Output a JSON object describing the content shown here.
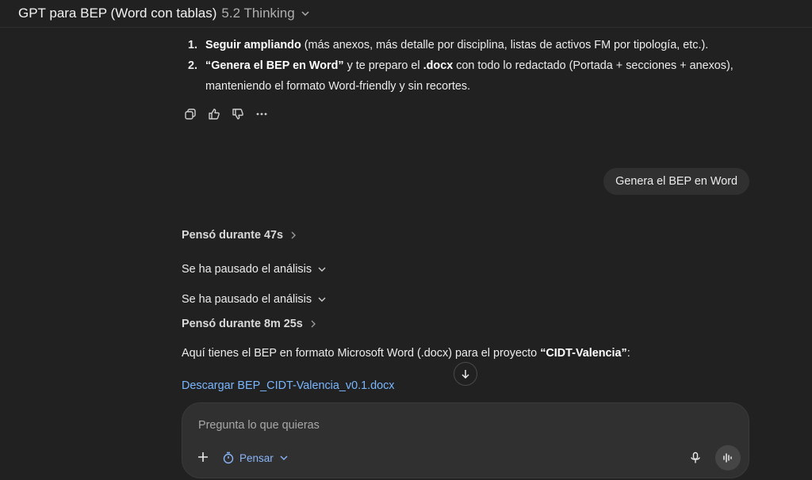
{
  "header": {
    "model_name": "GPT para BEP (Word con tablas)",
    "model_version": "5.2 Thinking"
  },
  "steps": [
    {
      "num": "1.",
      "bold": "Seguir ampliando",
      "text": " (más anexos, más detalle por disciplina, listas de activos FM por tipología, etc.)."
    },
    {
      "num": "2.",
      "bold_quote": "“Genera el BEP en Word”",
      "text_a": " y te preparo el ",
      "bold_docx": ".docx",
      "text_b": " con todo lo redactado (Portada + secciones + anexos),",
      "text_c": "manteniendo el formato Word-friendly y sin recortes."
    }
  ],
  "user_message": "Genera el BEP en Word",
  "thoughts": [
    {
      "label": "Pensó durante 47s"
    },
    {
      "label": "Se ha pausado el análisis"
    },
    {
      "label": "Se ha pausado el análisis"
    },
    {
      "label": "Pensó durante 8m 25s"
    }
  ],
  "reply": {
    "text": "Aquí tienes el BEP en formato Microsoft Word (.docx) para el proyecto ",
    "project": "“CIDT-Valencia”",
    "colon": ":"
  },
  "download_link": "Descargar BEP_CIDT-Valencia_v0.1.docx",
  "composer": {
    "placeholder": "Pregunta lo que quieras",
    "think_label": "Pensar"
  }
}
